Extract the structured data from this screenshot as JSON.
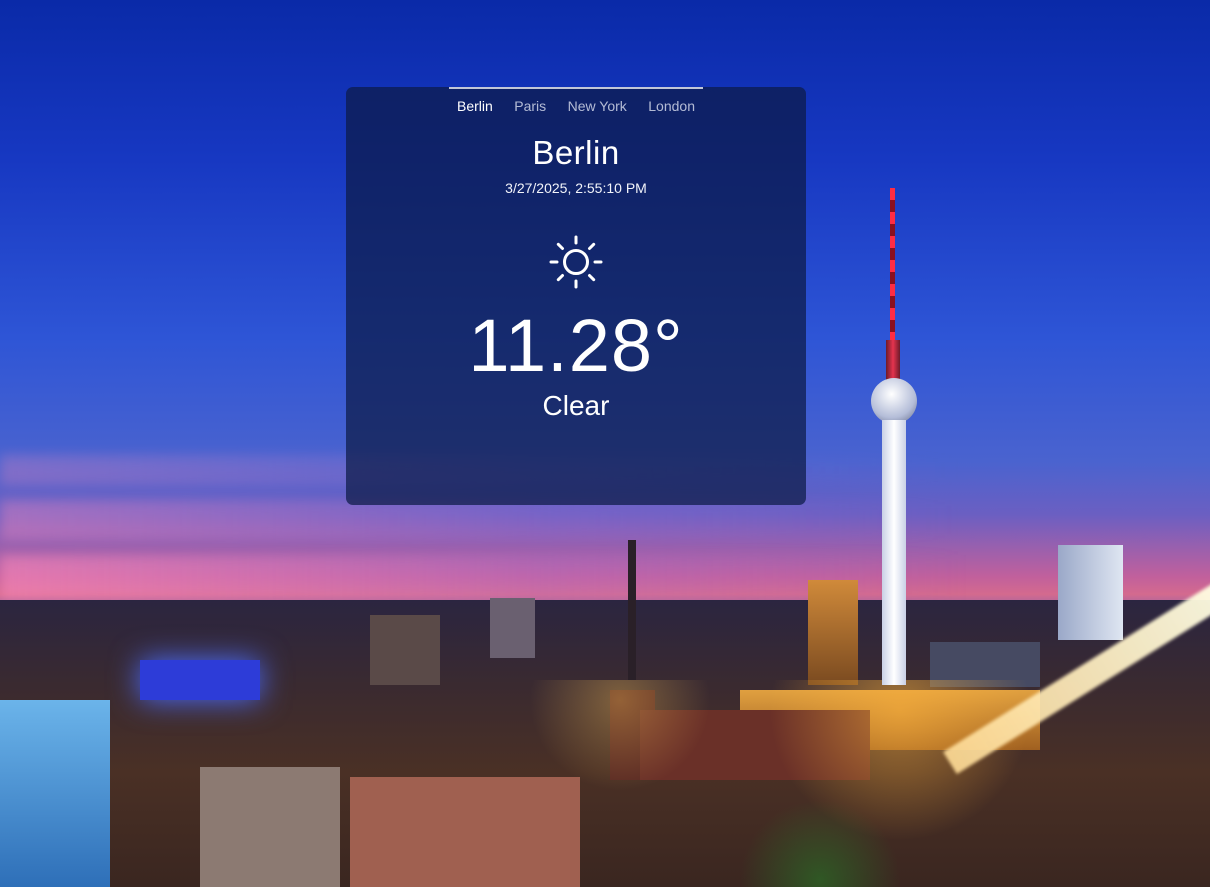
{
  "tabs": [
    {
      "label": "Berlin",
      "active": true
    },
    {
      "label": "Paris",
      "active": false
    },
    {
      "label": "New York",
      "active": false
    },
    {
      "label": "London",
      "active": false
    }
  ],
  "weather": {
    "city": "Berlin",
    "datetime": "3/27/2025, 2:55:10 PM",
    "icon": "sun-icon",
    "temperature": "11.28°",
    "condition": "Clear"
  },
  "colors": {
    "card_background": "#0c1a46",
    "text": "#ffffff",
    "tab_inactive": "#dce1f0"
  }
}
